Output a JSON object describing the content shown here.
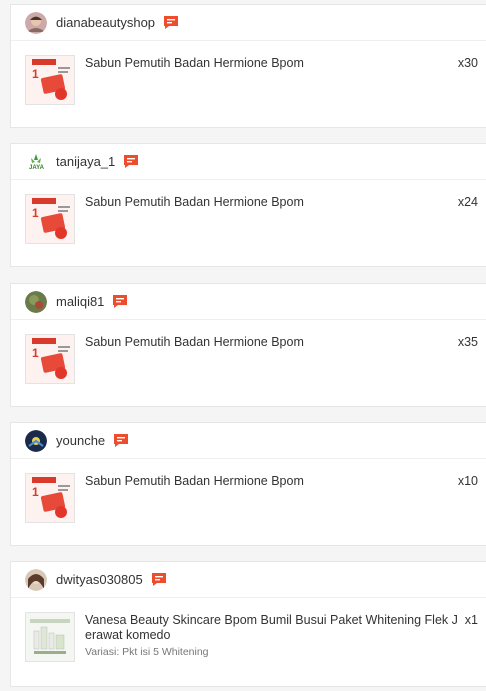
{
  "orders": [
    {
      "username": "dianabeautyshop",
      "product": "Sabun Pemutih Badan Hermione Bpom",
      "qty": "x30",
      "variant": "",
      "avatar": "avatar-1"
    },
    {
      "username": "tanijaya_1",
      "product": "Sabun Pemutih Badan Hermione Bpom",
      "qty": "x24",
      "variant": "",
      "avatar": "avatar-2"
    },
    {
      "username": "maliqi81",
      "product": "Sabun Pemutih Badan Hermione Bpom",
      "qty": "x35",
      "variant": "",
      "avatar": "avatar-3"
    },
    {
      "username": "younche",
      "product": "Sabun Pemutih Badan Hermione Bpom",
      "qty": "x10",
      "variant": "",
      "avatar": "avatar-4"
    },
    {
      "username": "dwityas030805",
      "product": "Vanesa Beauty Skincare Bpom Bumil Busui Paket Whitening Flek J erawat komedo",
      "qty": "x1",
      "variant": "Variasi: Pkt isi 5 Whitening",
      "avatar": "avatar-5"
    }
  ],
  "colors": {
    "accent": "#ee4d2d",
    "border": "#e6e6e6"
  },
  "icons": {
    "chat": "chat-icon"
  }
}
